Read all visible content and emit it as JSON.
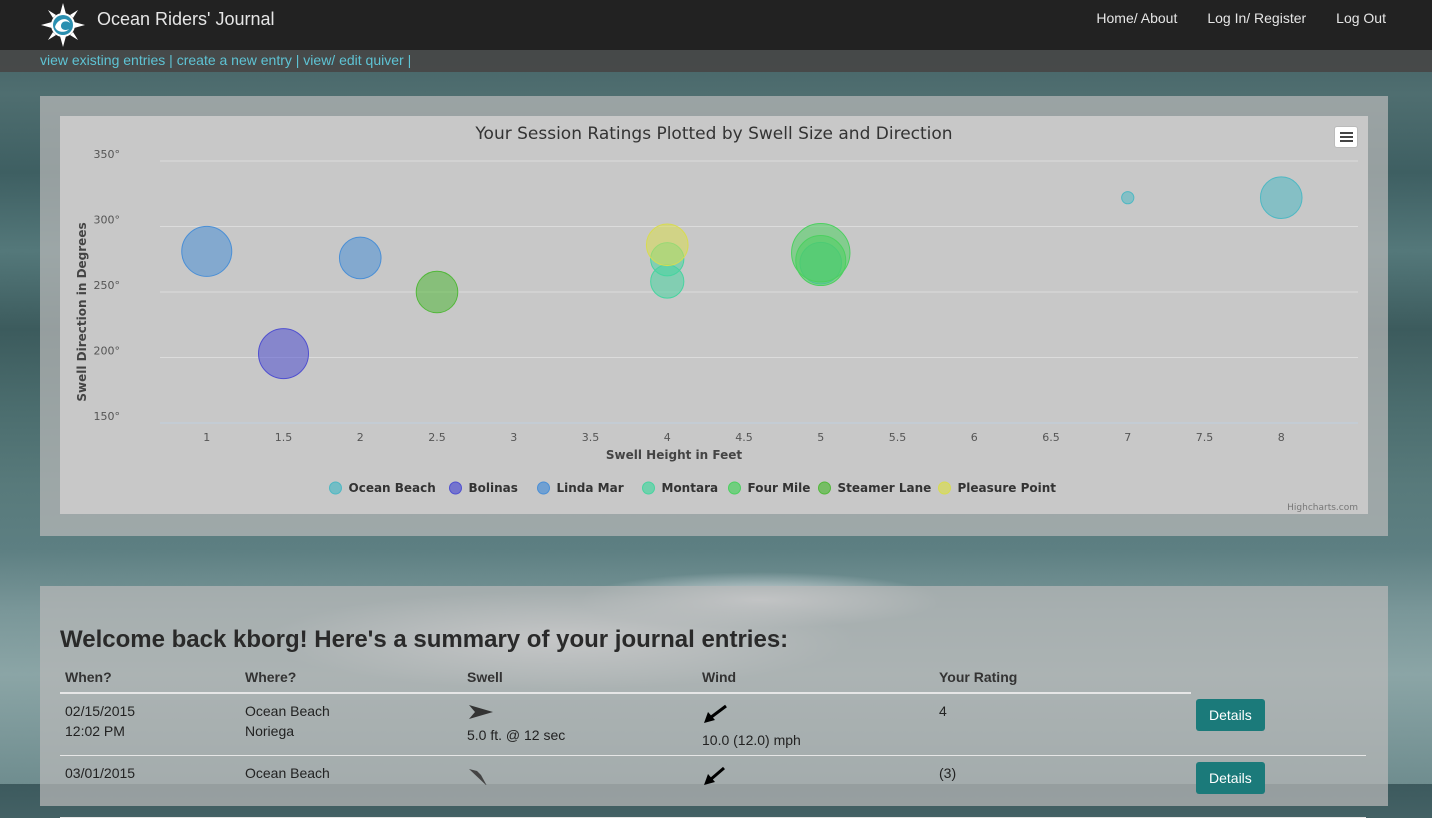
{
  "navbar": {
    "brand": "Ocean Riders' Journal",
    "links": [
      "Home/ About",
      "Log In/ Register",
      "Log Out"
    ]
  },
  "subnav": {
    "links": [
      "view existing entries |",
      "create a new entry |",
      "view/ edit quiver |"
    ]
  },
  "chart": {
    "menu_icon": "hamburger-icon",
    "credit": "Highcharts.com"
  },
  "chart_data": {
    "type": "scatter",
    "title": "Your Session Ratings Plotted by Swell Size and Direction",
    "xlabel": "Swell Height in Feet",
    "ylabel": "Swell Direction in Degrees",
    "xlim": [
      0.5,
      8.5
    ],
    "ylim": [
      150,
      350
    ],
    "x_ticks": [
      "1",
      "1.5",
      "2",
      "2.5",
      "3",
      "3.5",
      "4",
      "4.5",
      "5",
      "5.5",
      "6",
      "6.5",
      "7",
      "7.5",
      "8"
    ],
    "y_ticks": [
      "150°",
      "200°",
      "250°",
      "300°",
      "350°"
    ],
    "grid": true,
    "legend_position": "bottom",
    "series": [
      {
        "name": "Ocean Beach",
        "color": "#4fb8c3",
        "points": [
          {
            "x": 5,
            "y": 272,
            "r": 4
          },
          {
            "x": 7,
            "y": 322,
            "r": 0.5
          },
          {
            "x": 8,
            "y": 322,
            "r": 4
          }
        ]
      },
      {
        "name": "Bolinas",
        "color": "#5050d0",
        "points": [
          {
            "x": 1.5,
            "y": 203,
            "r": 5
          }
        ]
      },
      {
        "name": "Linda Mar",
        "color": "#4a8fd6",
        "points": [
          {
            "x": 1,
            "y": 281,
            "r": 5
          },
          {
            "x": 2,
            "y": 276,
            "r": 4
          }
        ]
      },
      {
        "name": "Montara",
        "color": "#48d4a0",
        "points": [
          {
            "x": 4,
            "y": 258,
            "r": 3
          },
          {
            "x": 4,
            "y": 275,
            "r": 3
          }
        ]
      },
      {
        "name": "Four Mile",
        "color": "#4cd060",
        "points": [
          {
            "x": 5,
            "y": 280,
            "r": 6
          },
          {
            "x": 5,
            "y": 274,
            "r": 5
          }
        ]
      },
      {
        "name": "Steamer Lane",
        "color": "#52b83a",
        "points": [
          {
            "x": 2.5,
            "y": 250,
            "r": 4
          }
        ]
      },
      {
        "name": "Pleasure Point",
        "color": "#d8dc50",
        "points": [
          {
            "x": 4,
            "y": 286,
            "r": 4
          }
        ]
      }
    ]
  },
  "summary": {
    "welcome": "Welcome back kborg! Here's a summary of your journal entries:",
    "headers": [
      "When?",
      "Where?",
      "Swell",
      "Wind",
      "Your Rating",
      ""
    ],
    "rows": [
      {
        "date": "02/15/2015",
        "time": "12:02 PM",
        "spot": "Ocean Beach",
        "subspot": "Noriega",
        "swell": "5.0 ft. @ 12 sec",
        "wind": "10.0 (12.0) mph",
        "rating": "4",
        "button": "Details"
      },
      {
        "date": "03/01/2015",
        "time": "",
        "spot": "Ocean Beach",
        "subspot": "",
        "swell": "",
        "wind": "",
        "rating": "(3)",
        "button": "Details"
      }
    ]
  }
}
